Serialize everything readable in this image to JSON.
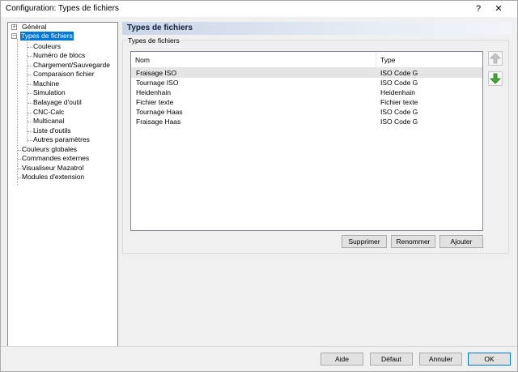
{
  "window": {
    "title": "Configuration: Types de fichiers",
    "help_label": "?",
    "close_label": "✕"
  },
  "tree": {
    "items": [
      {
        "label": "Général"
      },
      {
        "label": "Types de fichiers"
      },
      {
        "label": "Couleurs"
      },
      {
        "label": "Numéro de blocs"
      },
      {
        "label": "Chargement/Sauvegarde"
      },
      {
        "label": "Comparaison fichier"
      },
      {
        "label": "Machine"
      },
      {
        "label": "Simulation"
      },
      {
        "label": "Balayage d'outil"
      },
      {
        "label": "CNC-Calc"
      },
      {
        "label": "Multicanal"
      },
      {
        "label": "Liste d'outils"
      },
      {
        "label": "Autres paramètres"
      },
      {
        "label": "Couleurs globales"
      },
      {
        "label": "Commandes externes"
      },
      {
        "label": "Visualiseur Mazatrol"
      },
      {
        "label": "Modules d'extension"
      }
    ],
    "expander_collapsed": "+",
    "expander_expanded": "−"
  },
  "panel": {
    "header": "Types de fichiers",
    "group_label": "Types de fichiers",
    "columns": [
      "Nom",
      "Type"
    ],
    "rows": [
      {
        "name": "Fraisage ISO",
        "type": "ISO Code G"
      },
      {
        "name": "Tournage ISO",
        "type": "ISO Code G"
      },
      {
        "name": "Heidenhain",
        "type": "Heidenhain"
      },
      {
        "name": "Fichier texte",
        "type": "Fichier texte"
      },
      {
        "name": "Tournage Haas",
        "type": "ISO Code G"
      },
      {
        "name": "Fraisage Haas",
        "type": "ISO Code G"
      }
    ],
    "buttons": {
      "delete": "Supprimer",
      "rename": "Renommer",
      "add": "Ajouter"
    },
    "move_up_icon": "arrow-up-icon",
    "move_down_icon": "arrow-down-icon"
  },
  "footer": {
    "help": "Aide",
    "default": "Défaut",
    "cancel": "Annuler",
    "ok": "OK"
  },
  "colors": {
    "selection": "#0078d7",
    "header_gradient_start": "#c9d6e8",
    "arrow_up_disabled": "#b5b5b5",
    "arrow_down": "#3a9a2a"
  }
}
